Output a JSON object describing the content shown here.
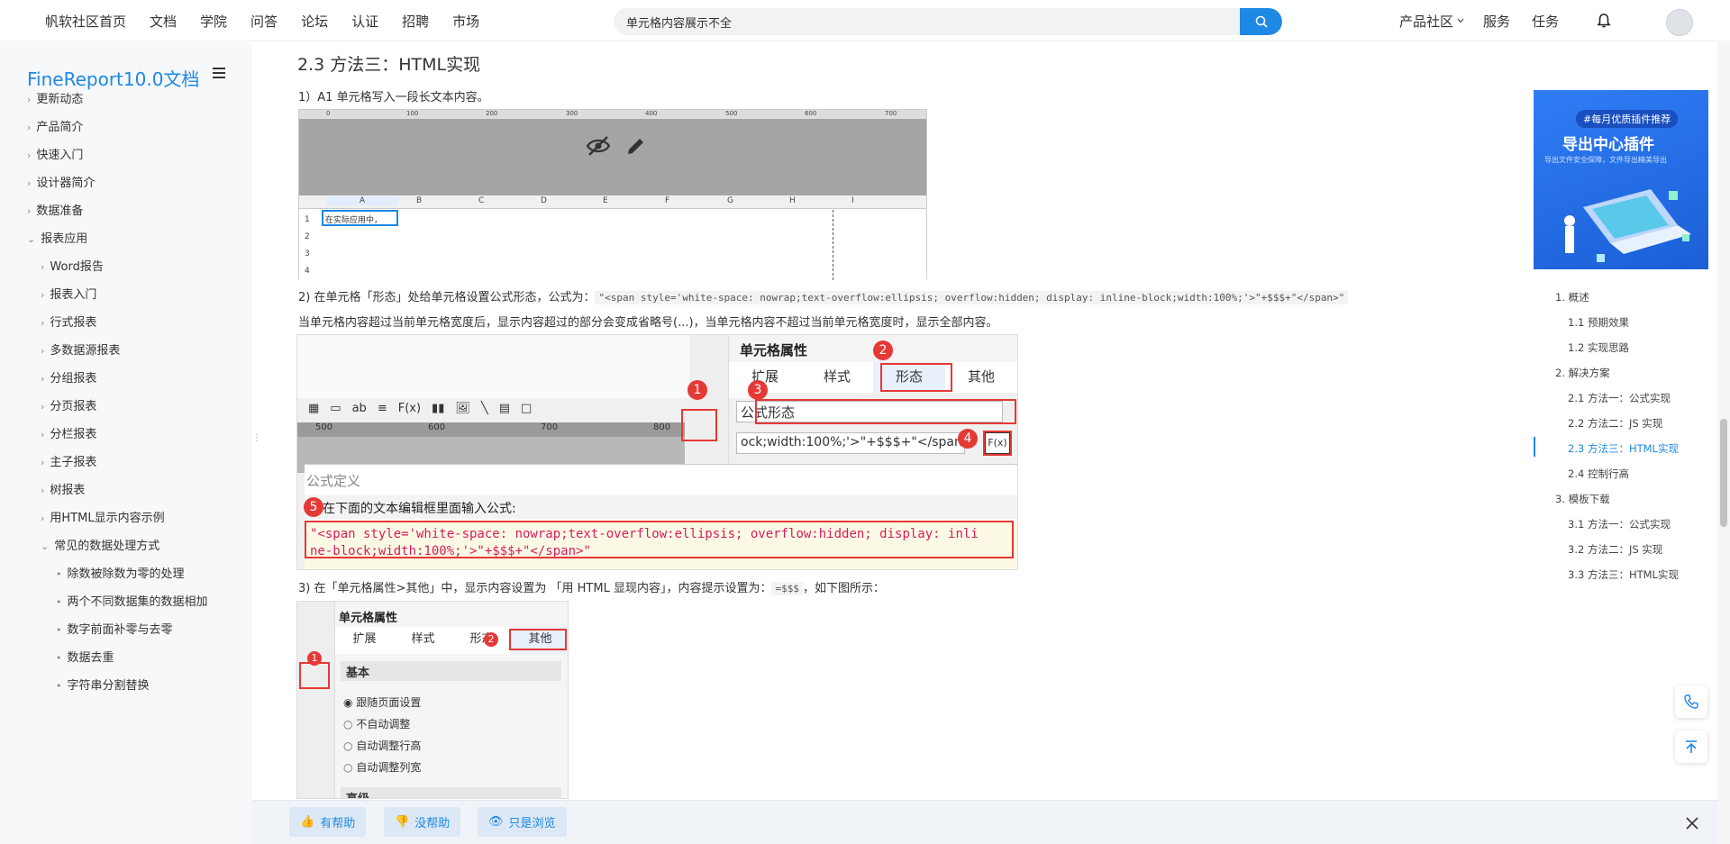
{
  "topnav": {
    "links": [
      "帆软社区首页",
      "文档",
      "学院",
      "问答",
      "论坛",
      "认证",
      "招聘",
      "市场"
    ],
    "search_value": "单元格内容展示不全",
    "product": "产品社区",
    "service": "服务",
    "task": "任务"
  },
  "sidebar": {
    "title": "FineReport10.0文档",
    "items": [
      "更新动态",
      "产品简介",
      "快速入门",
      "设计器简介",
      "数据准备",
      "报表应用",
      "Word报告",
      "报表入门",
      "行式报表",
      "多数据源报表",
      "分组报表",
      "分页报表",
      "分栏报表",
      "主子报表",
      "树报表",
      "用HTML显示内容示例",
      "常见的数据处理方式",
      "除数被除数为零的处理",
      "两个不同数据集的数据相加",
      "数字前面补零与去零",
      "数据去重",
      "字符串分割替换"
    ]
  },
  "article": {
    "heading": "2.3 方法三：HTML实现",
    "step1": "1）A1 单元格写入一段长文本内容。",
    "step2_prefix": "2) 在单元格「形态」处给单元格设置公式形态，公式为：",
    "step2_code": "\"<span style='white-space: nowrap;text-overflow:ellipsis; overflow:hidden; display: inline-block;width:100%;'>\"+$$$+\"</span>\"",
    "step2_note": "当单元格内容超过当前单元格宽度后，显示内容超过的部分会变成省略号(...)，当单元格内容不超过当前单元格宽度时，显示全部内容。",
    "step3_a": "3) 在「单元格属性>其他」中，显示内容设置为 「用 HTML 显现内容」，内容提示设置为：",
    "step3_code": "=$$$",
    "step3_b": "，如下图所示："
  },
  "img1": {
    "ruler": [
      "0",
      "100",
      "200",
      "300",
      "400",
      "500",
      "600",
      "700"
    ],
    "cols": [
      "A",
      "B",
      "C",
      "D",
      "E",
      "F",
      "G",
      "H",
      "I"
    ],
    "rows": [
      "1",
      "2",
      "3",
      "4"
    ],
    "cell_a1": "在实际应用中，"
  },
  "img2": {
    "panel_title": "单元格属性",
    "tabs": [
      "扩展",
      "样式",
      "形态",
      "其他"
    ],
    "select": "公式形态",
    "formula_input": "ock;width:100%;'>\"+$$$+\"</span>",
    "fx": "F(x)",
    "ruler": [
      "500",
      "600",
      "700",
      "800"
    ],
    "dialog_title": "公式定义",
    "dialog_hint": "在下面的文本编辑框里面输入公式:",
    "code_line1": "\"<span style='white-space: nowrap;text-overflow:ellipsis; overflow:hidden; display: inli",
    "code_line2": "ne-block;width:100%;'>\"+$$$+\"</span>\"",
    "badges": [
      "1",
      "2",
      "3",
      "4",
      "5"
    ]
  },
  "img3": {
    "panel_title": "单元格属性",
    "tabs": [
      "扩展",
      "样式",
      "形态",
      "其他"
    ],
    "section1": "基本",
    "options": [
      "跟随页面设置",
      "不自动调整",
      "自动调整行高",
      "自动调整列宽"
    ],
    "section2": "高级",
    "badges": [
      "1",
      "2"
    ]
  },
  "banner": {
    "tag": "#每月优质插件推荐",
    "title": "导出中心插件",
    "subtitle": "导出文件安全保障，文件导出精美导出"
  },
  "toc": [
    "1. 概述",
    "1.1 预期效果",
    "1.2 实现思路",
    "2. 解决方案",
    "2.1 方法一：公式实现",
    "2.2 方法二：JS 实现",
    "2.3 方法三：HTML实现",
    "2.4 控制行高",
    "3. 模板下载",
    "3.1 方法一：公式实现",
    "3.2 方法二：JS 实现",
    "3.3 方法三：HTML实现"
  ],
  "footer": {
    "helpful": "有帮助",
    "not_helpful": "没帮助",
    "browse": "只是浏览"
  },
  "colors": {
    "accent": "#1e88e5",
    "red": "#e53935"
  }
}
